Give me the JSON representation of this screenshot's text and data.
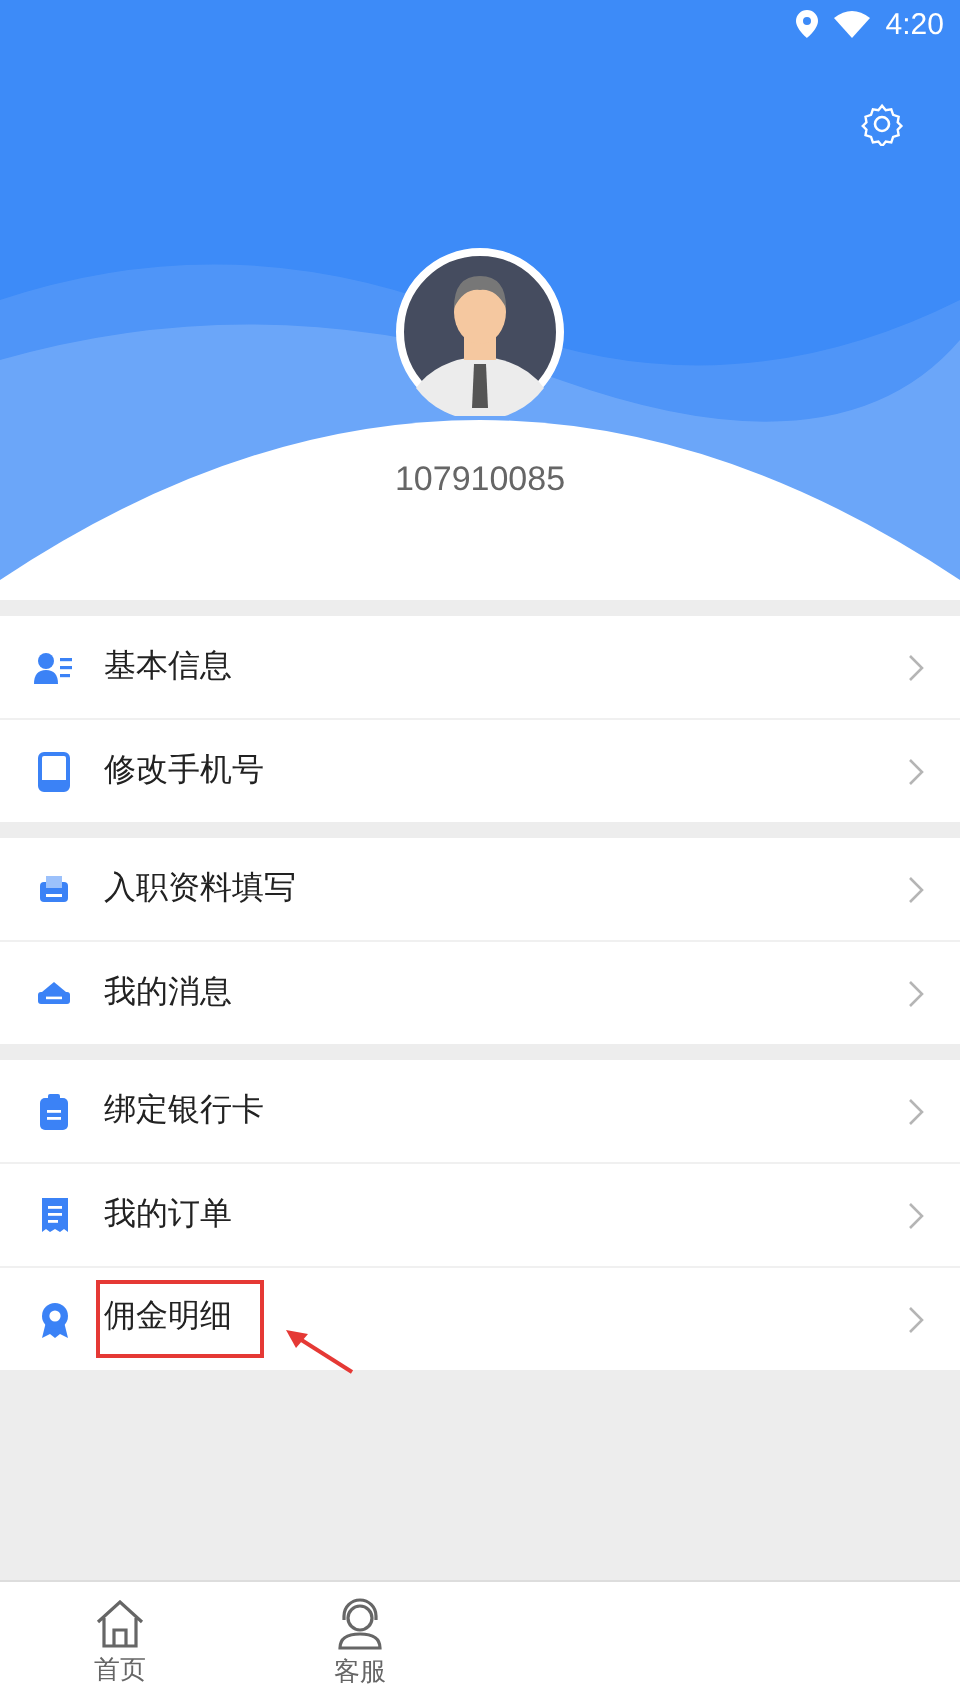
{
  "status_bar": {
    "time": "4:20"
  },
  "profile": {
    "user_id": "107910085"
  },
  "sections": [
    [
      {
        "label": "基本信息",
        "kind": "person",
        "annotated": false
      },
      {
        "label": "修改手机号",
        "kind": "tablet",
        "annotated": false
      }
    ],
    [
      {
        "label": "入职资料填写",
        "kind": "printer",
        "annotated": false
      },
      {
        "label": "我的消息",
        "kind": "tray",
        "annotated": false
      }
    ],
    [
      {
        "label": "绑定银行卡",
        "kind": "clipboard",
        "annotated": false
      },
      {
        "label": "我的订单",
        "kind": "receipt",
        "annotated": false
      },
      {
        "label": "佣金明细",
        "kind": "ribbon",
        "annotated": true
      }
    ]
  ],
  "bottom_nav": [
    {
      "label": "首页",
      "kind": "home"
    },
    {
      "label": "客服",
      "kind": "headset"
    }
  ]
}
